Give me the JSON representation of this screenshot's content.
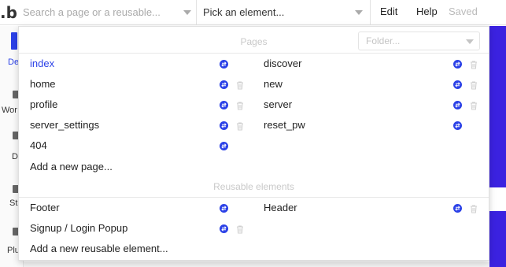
{
  "topbar": {
    "logo": ".b",
    "page_placeholder": "Search a page or a reusable...",
    "element_placeholder": "Pick an element...",
    "menu": {
      "edit": "Edit",
      "help": "Help",
      "saved": "Saved"
    }
  },
  "left_tabs": [
    {
      "label": "De"
    },
    {
      "label": "Wor"
    },
    {
      "label": "D"
    },
    {
      "label": "St"
    },
    {
      "label": "Plu"
    }
  ],
  "dropdown": {
    "pages_header": "Pages",
    "folder_placeholder": "Folder...",
    "pages_left": [
      {
        "name": "index",
        "current": true,
        "convert_icon": "convert-icon",
        "delete_icon": ""
      },
      {
        "name": "home",
        "convert_icon": "convert-icon",
        "delete_icon": "trash-icon"
      },
      {
        "name": "profile",
        "convert_icon": "convert-icon",
        "delete_icon": "trash-icon"
      },
      {
        "name": "server_settings",
        "convert_icon": "convert-icon",
        "delete_icon": "trash-icon"
      },
      {
        "name": "404",
        "convert_icon": "convert-icon",
        "delete_icon": ""
      }
    ],
    "pages_right": [
      {
        "name": "discover",
        "convert_icon": "convert-icon",
        "delete_icon": "trash-icon"
      },
      {
        "name": "new",
        "convert_icon": "convert-icon",
        "delete_icon": "trash-icon"
      },
      {
        "name": "server",
        "convert_icon": "convert-icon",
        "delete_icon": "trash-icon"
      },
      {
        "name": "reset_pw",
        "convert_icon": "convert-icon",
        "delete_icon": ""
      }
    ],
    "add_page": "Add a new page...",
    "reusable_header": "Reusable elements",
    "reusable_left": [
      {
        "name": "Footer",
        "convert_icon": "convert-icon",
        "delete_icon": ""
      },
      {
        "name": "Signup / Login Popup",
        "convert_icon": "convert-icon",
        "delete_icon": "trash-icon"
      }
    ],
    "reusable_right": [
      {
        "name": "Header",
        "convert_icon": "convert-icon",
        "delete_icon": "trash-icon"
      }
    ],
    "add_reusable": "Add a new reusable element..."
  },
  "colors": {
    "accent": "#2b41e7",
    "canvas": "#3b22e0",
    "muted": "#c9c9c9"
  }
}
